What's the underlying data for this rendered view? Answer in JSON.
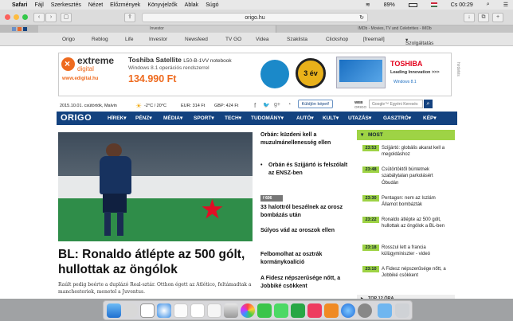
{
  "menubar": {
    "apple_icon": "apple-icon",
    "items": [
      "Safari",
      "Fájl",
      "Szerkesztés",
      "Nézet",
      "Előzmények",
      "Könyvjelzők",
      "Ablak",
      "Súgó"
    ],
    "battery": "89%",
    "clock": "Cs 00:29"
  },
  "toolbar": {
    "url": "origo.hu"
  },
  "tabs": [
    "Investor",
    "IMDb - Movies, TV and Celebrities - IMDb"
  ],
  "favorites": [
    "Origo",
    "Reblog",
    "Life",
    "Investor",
    "Newsfeed",
    "TV GO",
    "Videa",
    "Szaklista",
    "Clickshop",
    "[freemail]",
    "Szolgáltatás"
  ],
  "ad": {
    "brand1": "extreme",
    "brand2": "digital",
    "site": "www.edigital.hu",
    "product": "Toshiba Satellite",
    "model": "L50-B-1VV notebook",
    "os": "Windows 8.1 operációs rendszerrel",
    "price": "134.990 Ft",
    "badge": "3 év",
    "toshiba": "TOSHIBA",
    "slogan": "Leading Innovation >>>",
    "win": "Windows 8.1"
  },
  "dateline": {
    "date": "2015.10.01. csütörtök, Malvin",
    "weather": "-2°C / 20°C",
    "eur": "EUR: 314 Ft",
    "gbp": "GBP: 424 Ft",
    "send_button": "Küldjön képet!",
    "web_label": "WEB",
    "origo_label": "ORIGO",
    "search_placeholder": "Google™ Egyéni Keresés"
  },
  "nav": {
    "logo": "ORIGO",
    "items": [
      "HÍREK",
      "PÉNZ",
      "MÉDIA",
      "SPORT",
      "TECH",
      "TUDOMÁNY",
      "AUTÓ",
      "KULT",
      "UTAZÁS",
      "GASZTRÓ",
      "KÉP"
    ]
  },
  "hero": {
    "title": "BL: Ronaldo átlépte az 500 gólt, hullottak az öngólok",
    "lead": "Raúlt pedig beérte a duplázó Real-sztár. Otthon égett az Atlético, feltámadtak a manchesteriek, menetel a Juventus."
  },
  "midcol": [
    {
      "title": "Orbán: küzdeni kell a muzulmánellenesség ellen"
    },
    {
      "title": "Orbán és Szijjártó is felszólalt az ENSZ-ben"
    },
    {
      "badge": "606"
    },
    {
      "title": "33 halottról beszélnek az orosz bombázás után"
    },
    {
      "title": "Súlyos vád az oroszok ellen"
    },
    {
      "title": "Felbomolhat az osztrák kormánykoalíció"
    },
    {
      "title": "A Fidesz népszerűsége nőtt, a Jobbiké csökkent"
    }
  ],
  "most": {
    "header": "MOST",
    "rows": [
      {
        "time": "23:53",
        "text": "Szijjártó: globális akarat kell a megoldáshoz"
      },
      {
        "time": "23:48",
        "text": "Csütörtöktől büntetnek szabálytalan parkolásért Óbudán"
      },
      {
        "time": "23:30",
        "text": "Pentagon: nem az Iszlám Államot bombázták"
      },
      {
        "time": "23:22",
        "text": "Ronaldo átlépte az 500 gólt, hullottak az öngólok a BL-ben"
      },
      {
        "time": "23:18",
        "text": "Rosszul lett a francia külügyminiszter - videó"
      },
      {
        "time": "23:10",
        "text": "A Fidesz népszerűsége nőtt, a Jobbiké csökkent"
      }
    ],
    "top12": "TOP 12 ÓRA"
  },
  "ad_side": "hirdetés"
}
